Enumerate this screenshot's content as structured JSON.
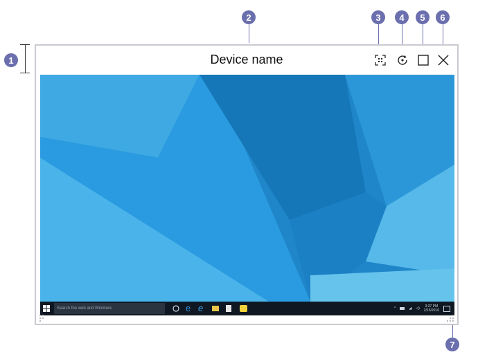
{
  "window": {
    "title": "Device name"
  },
  "callouts": [
    "1",
    "2",
    "3",
    "4",
    "5",
    "6",
    "7"
  ],
  "taskbar": {
    "search_placeholder": "Search the web and Windows",
    "clock_time": "3:37 PM",
    "clock_date": "2/15/2016"
  },
  "icons": {
    "capture": "screen-capture-icon",
    "rotate": "rotate-icon",
    "maximize": "maximize-icon",
    "close": "close-icon",
    "resize": "resize-grip-icon"
  },
  "colors": {
    "callout": "#6b6fae",
    "window_border": "#c9c9d0",
    "taskbar": "#0f1822"
  }
}
